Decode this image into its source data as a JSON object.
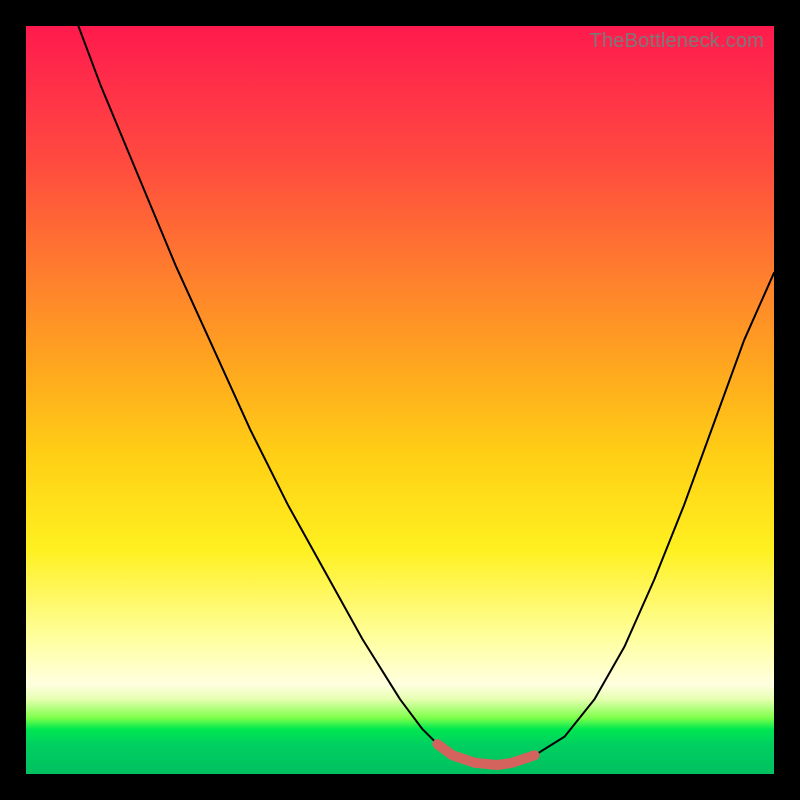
{
  "watermark": "TheBottleneck.com",
  "colors": {
    "frame": "#000000",
    "curve": "#000000",
    "highlight": "#d4635d",
    "gradient_top": "#ff1a4d",
    "gradient_bottom": "#00c060"
  },
  "chart_data": {
    "type": "line",
    "title": "",
    "xlabel": "",
    "ylabel": "",
    "xlim": [
      0,
      100
    ],
    "ylim": [
      0,
      100
    ],
    "series": [
      {
        "name": "curve",
        "x": [
          7,
          10,
          15,
          20,
          25,
          30,
          35,
          40,
          45,
          50,
          53,
          55,
          57,
          60,
          63,
          65,
          68,
          72,
          76,
          80,
          84,
          88,
          92,
          96,
          100
        ],
        "y": [
          100,
          92,
          80,
          68,
          57,
          46,
          36,
          27,
          18,
          10,
          6,
          4,
          2.5,
          1.5,
          1.2,
          1.5,
          2.5,
          5,
          10,
          17,
          26,
          36,
          47,
          58,
          67
        ]
      },
      {
        "name": "bottom-highlight",
        "x": [
          55,
          57,
          60,
          63,
          65,
          68
        ],
        "y": [
          4,
          2.5,
          1.5,
          1.2,
          1.5,
          2.5
        ]
      }
    ],
    "annotations": [
      {
        "text": "TheBottleneck.com",
        "position": "top-right"
      }
    ]
  }
}
